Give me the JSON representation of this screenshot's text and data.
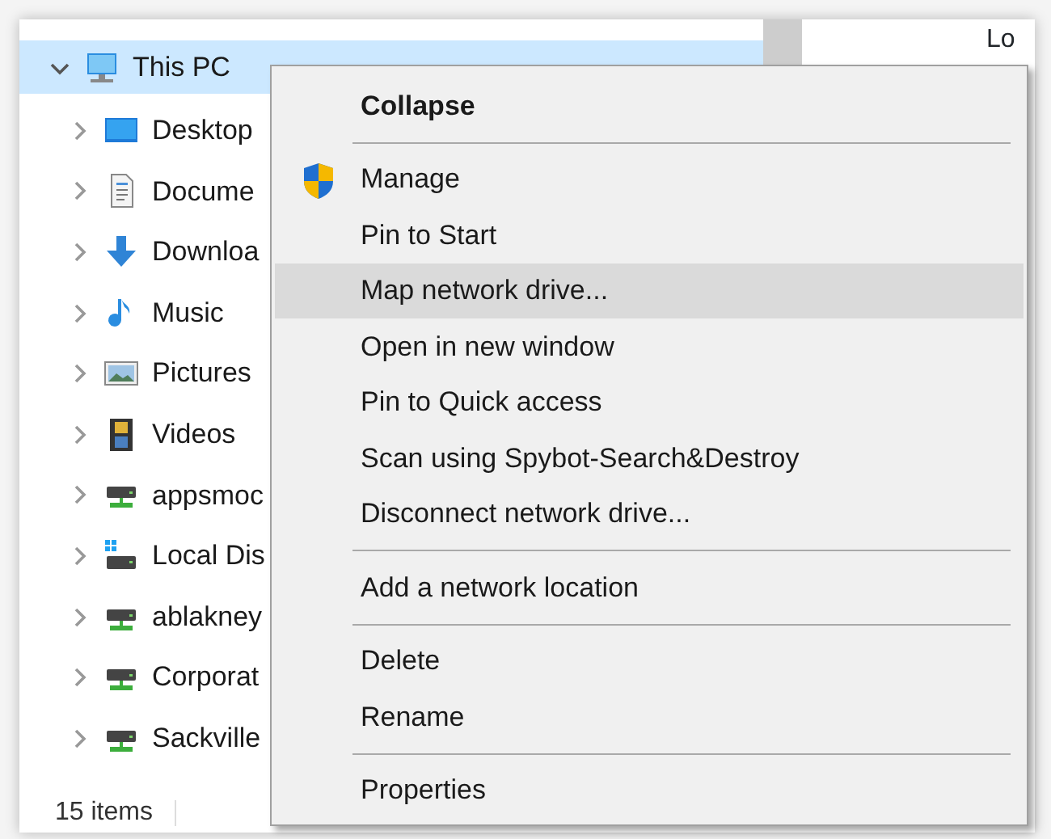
{
  "tree": {
    "items": [
      {
        "label": "This PC",
        "kind": "computer",
        "expanded": true,
        "selected": true,
        "children": [
          {
            "label": "Desktop",
            "kind": "desktop",
            "expanded": false,
            "selected": false
          },
          {
            "label": "Docume",
            "kind": "documents",
            "expanded": false,
            "selected": false
          },
          {
            "label": "Downloa",
            "kind": "downloads",
            "expanded": false,
            "selected": false
          },
          {
            "label": "Music",
            "kind": "music",
            "expanded": false,
            "selected": false
          },
          {
            "label": "Pictures",
            "kind": "pictures",
            "expanded": false,
            "selected": false
          },
          {
            "label": "Videos",
            "kind": "videos",
            "expanded": false,
            "selected": false
          },
          {
            "label": "appsmoc",
            "kind": "netdrive",
            "expanded": false,
            "selected": false
          },
          {
            "label": "Local Dis",
            "kind": "localdisk",
            "expanded": false,
            "selected": false
          },
          {
            "label": "ablakney",
            "kind": "netdrive",
            "expanded": false,
            "selected": false
          },
          {
            "label": "Corporat",
            "kind": "netdrive",
            "expanded": false,
            "selected": false
          },
          {
            "label": "Sackville",
            "kind": "netdrive",
            "expanded": false,
            "selected": false
          }
        ]
      }
    ]
  },
  "right_pane": {
    "column_1": "Lo"
  },
  "status_bar": {
    "item_count": "15 items"
  },
  "context_menu": {
    "items": [
      {
        "kind": "command",
        "label": "Collapse",
        "default": true,
        "selected": false
      },
      {
        "kind": "separator"
      },
      {
        "kind": "shield",
        "label": "Manage",
        "default": false,
        "selected": false
      },
      {
        "kind": "command",
        "label": "Pin to Start",
        "default": false,
        "selected": false
      },
      {
        "kind": "command",
        "label": "Map network drive...",
        "default": false,
        "selected": true
      },
      {
        "kind": "command",
        "label": "Open in new window",
        "default": false,
        "selected": false
      },
      {
        "kind": "command",
        "label": "Pin to Quick access",
        "default": false,
        "selected": false
      },
      {
        "kind": "command",
        "label": "Scan using Spybot-Search&Destroy",
        "default": false,
        "selected": false
      },
      {
        "kind": "command",
        "label": "Disconnect network drive...",
        "default": false,
        "selected": false
      },
      {
        "kind": "separator"
      },
      {
        "kind": "command",
        "label": "Add a network location",
        "default": false,
        "selected": false
      },
      {
        "kind": "separator"
      },
      {
        "kind": "command",
        "label": "Delete",
        "default": false,
        "selected": false
      },
      {
        "kind": "command",
        "label": "Rename",
        "default": false,
        "selected": false
      },
      {
        "kind": "separator"
      },
      {
        "kind": "command",
        "label": "Properties",
        "default": false,
        "selected": false
      }
    ]
  }
}
